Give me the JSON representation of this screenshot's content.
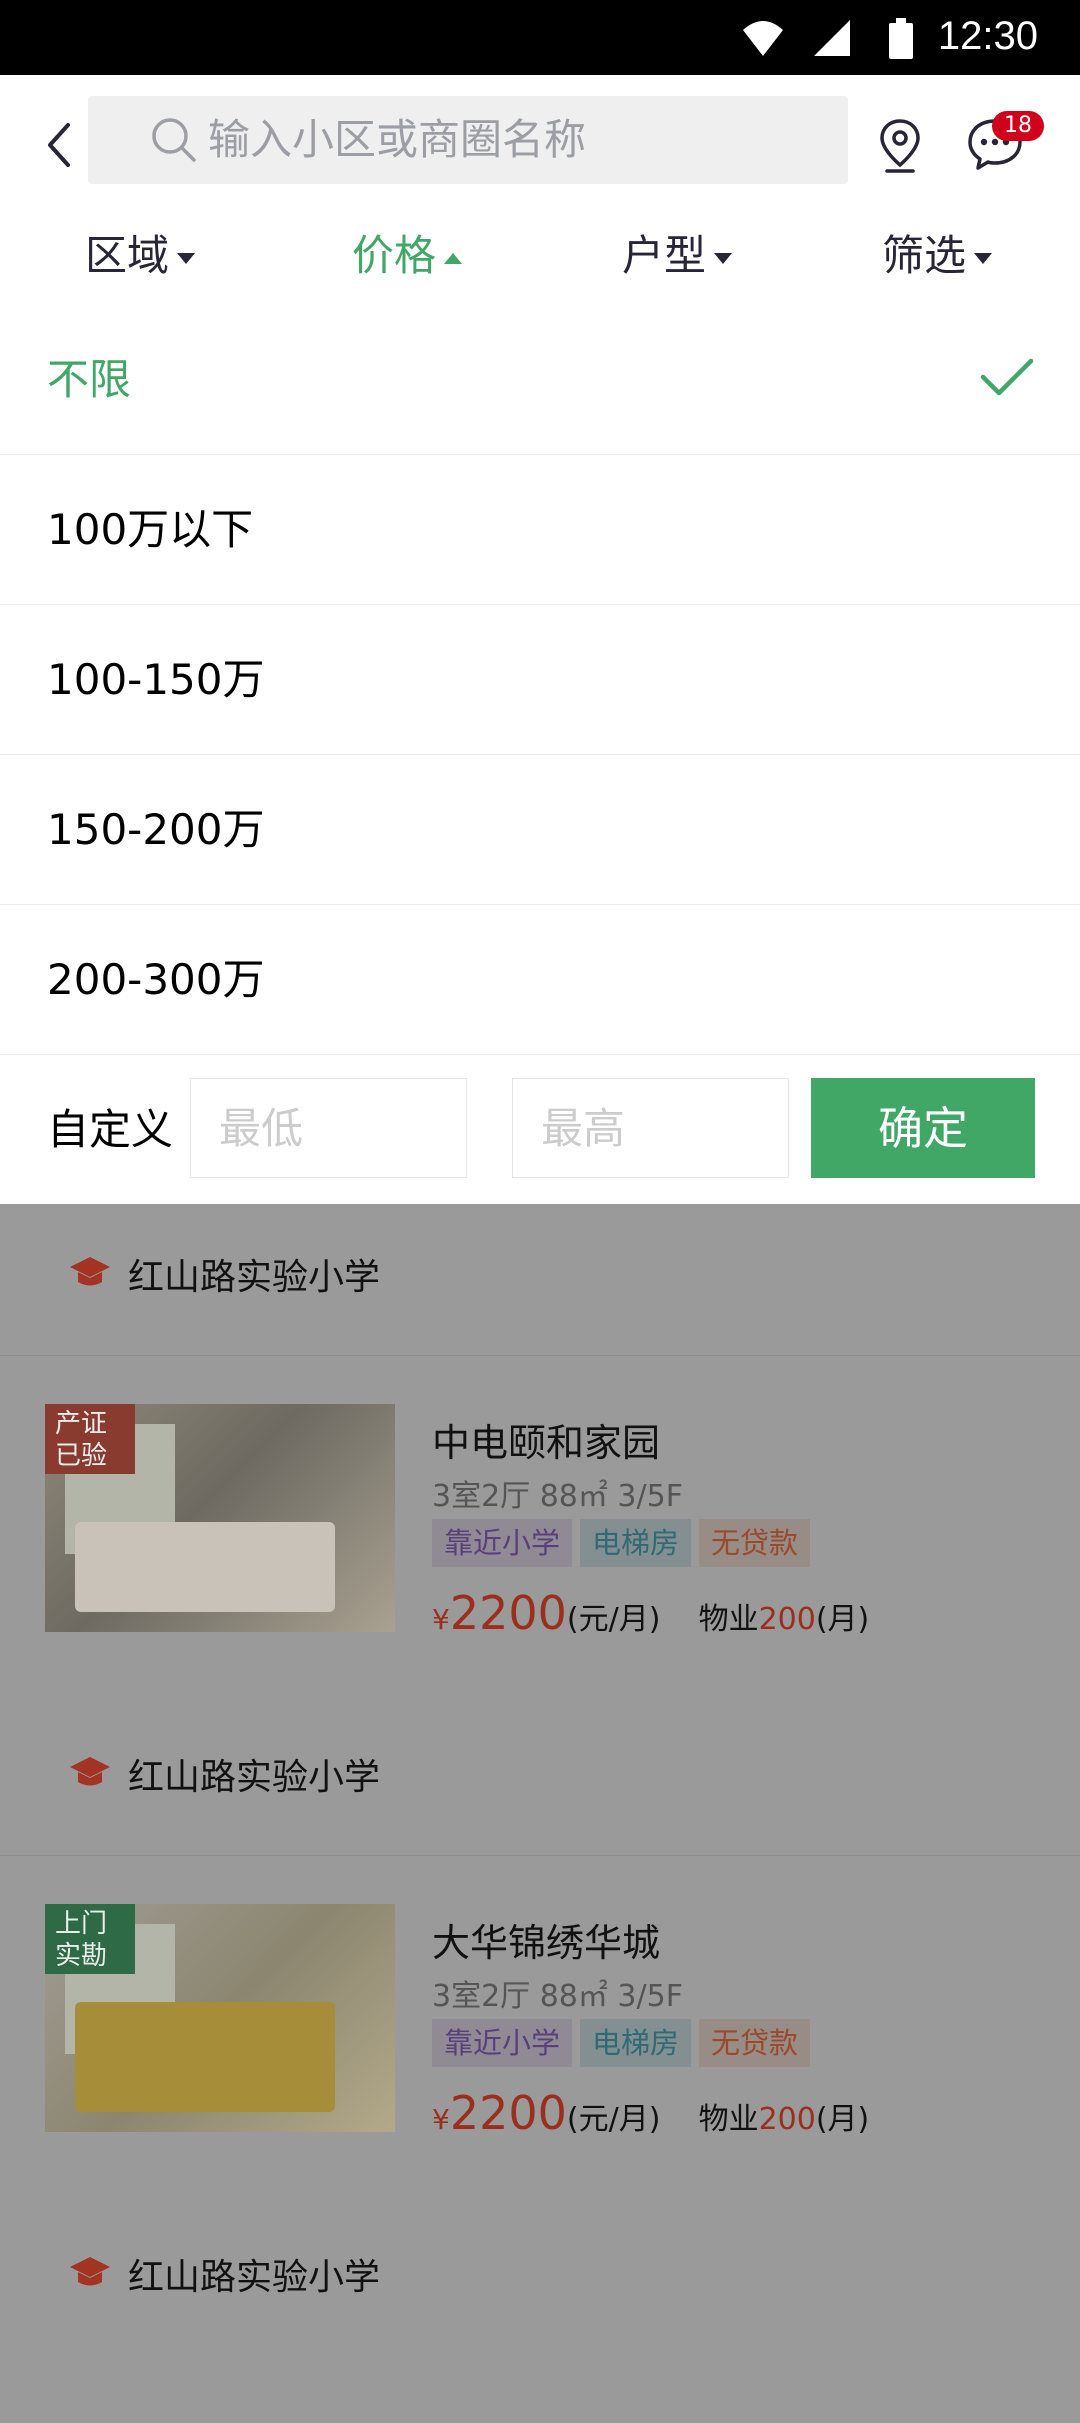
{
  "status_bar": {
    "time": "12:30"
  },
  "header": {
    "search_placeholder": "输入小区或商圈名称",
    "message_badge": "18"
  },
  "filter_tabs": [
    {
      "label": "区域"
    },
    {
      "label": "价格"
    },
    {
      "label": "户型"
    },
    {
      "label": "筛选"
    }
  ],
  "active_tab": "价格",
  "price_options": [
    {
      "label": "不限",
      "selected": true
    },
    {
      "label": "100万以下"
    },
    {
      "label": "100-150万"
    },
    {
      "label": "150-200万"
    },
    {
      "label": "200-300万"
    }
  ],
  "custom": {
    "label": "自定义",
    "min_placeholder": "最低",
    "max_placeholder": "最高",
    "confirm_label": "确定"
  },
  "listings": [
    {
      "school": "红山路实验小学"
    },
    {
      "badge": "产证已验",
      "badge_lines": [
        "产证",
        "已验"
      ],
      "title": "中电颐和家园",
      "meta": "3室2厅   88㎡  3/5F",
      "tags": [
        "靠近小学",
        "电梯房",
        "无贷款"
      ],
      "currency": "¥",
      "price": "2200",
      "price_unit": "(元/月)",
      "fee_label": "物业",
      "fee": "200",
      "fee_unit": "(月)",
      "school": "红山路实验小学"
    },
    {
      "badge": "上门实勘",
      "badge_lines": [
        "上门",
        "实勘"
      ],
      "title": "大华锦绣华城",
      "meta": "3室2厅   88㎡  3/5F",
      "tags": [
        "靠近小学",
        "电梯房",
        "无贷款"
      ],
      "currency": "¥",
      "price": "2200",
      "price_unit": "(元/月)",
      "fee_label": "物业",
      "fee": "200",
      "fee_unit": "(月)",
      "school": "红山路实验小学"
    }
  ],
  "colors": {
    "accent": "#41A766",
    "search_bg": "#EFEFEF",
    "placeholder": "#9C9EA5",
    "tab_text": "#272536",
    "input_placeholder": "#CCCCCC"
  }
}
